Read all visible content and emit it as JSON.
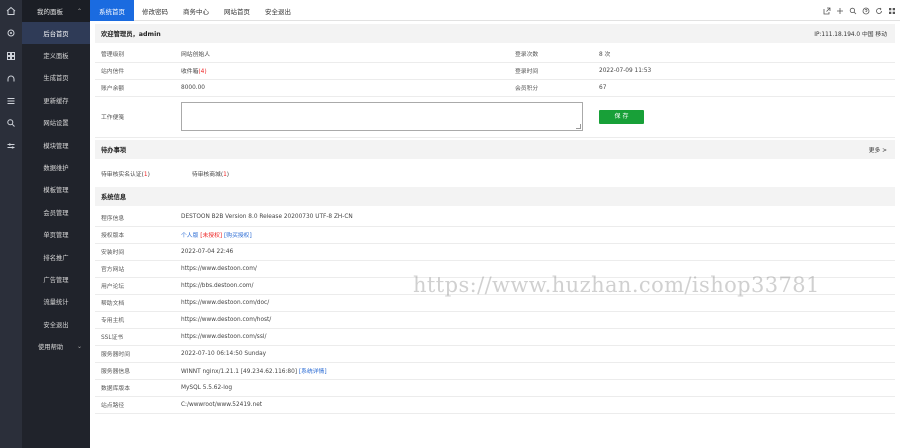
{
  "sidebar": {
    "header_label": "我的面板",
    "items": [
      {
        "label": "后台首页",
        "active": true
      },
      {
        "label": "定义面板"
      },
      {
        "label": "生成首页"
      },
      {
        "label": "更新缓存"
      },
      {
        "label": "网站设置"
      },
      {
        "label": "模块管理"
      },
      {
        "label": "数据维护"
      },
      {
        "label": "模板管理"
      },
      {
        "label": "会员管理"
      },
      {
        "label": "单页管理"
      },
      {
        "label": "排名推广"
      },
      {
        "label": "广告管理"
      },
      {
        "label": "流量统计"
      },
      {
        "label": "安全退出"
      }
    ],
    "footer_label": "使用帮助"
  },
  "rail_icons": [
    "home-icon",
    "gear-icon",
    "grid-icon",
    "user-icon",
    "list-icon",
    "search-icon",
    "sliders-icon"
  ],
  "topbar": {
    "tabs": [
      "系统首页",
      "修改密码",
      "商务中心",
      "网站首页",
      "安全退出"
    ],
    "icons": [
      "external-link-icon",
      "plus-icon",
      "search-icon",
      "help-icon",
      "refresh-icon",
      "grid-icon"
    ]
  },
  "welcome": {
    "title": "欢迎管理员，admin",
    "ip_info": "IP:111.18.194.0 中国 移动"
  },
  "admin_info": {
    "role_label": "管理级别",
    "role_value": "网站创始人",
    "login_count_label": "登录次数",
    "login_count_value": "8 次",
    "messages_label": "站内信件",
    "messages_value": "收件箱",
    "messages_count": "(4)",
    "last_login_label": "登录时间",
    "last_login_value": "2022-07-09 11:53",
    "balance_label": "账户余额",
    "balance_value": "8000.00",
    "points_label": "会员积分",
    "points_value": "67",
    "memo_label": "工作便笺",
    "save_button": "保 存"
  },
  "todo": {
    "title": "待办事项",
    "more": "更多",
    "items": [
      {
        "label": "待审核实名认证",
        "count": "1"
      },
      {
        "label": "待审核商城",
        "count": "1"
      }
    ]
  },
  "sysinfo": {
    "title": "系统信息",
    "rows": [
      {
        "label": "程序信息",
        "value": "DESTOON B2B Version 8.0 Release 20200730 UTF-8 ZH-CN"
      },
      {
        "label": "授权版本",
        "value": "个人版",
        "extra1": "[未授权]",
        "extra2": "[购买授权]"
      },
      {
        "label": "安装时间",
        "value": "2022-07-04 22:46"
      },
      {
        "label": "官方网站",
        "value": "https://www.destoon.com/"
      },
      {
        "label": "用户论坛",
        "value": "https://bbs.destoon.com/"
      },
      {
        "label": "帮助文档",
        "value": "https://www.destoon.com/doc/"
      },
      {
        "label": "专用主机",
        "value": "https://www.destoon.com/host/"
      },
      {
        "label": "SSL证书",
        "value": "https://www.destoon.com/ssl/"
      },
      {
        "label": "服务器时间",
        "value": "2022-07-10 06:14:50 Sunday"
      },
      {
        "label": "服务器信息",
        "value": "WINNT nginx/1.21.1 [49.234.62.116:80]",
        "extra1": "[系统详情]"
      },
      {
        "label": "数据库版本",
        "value": "MySQL 5.5.62-log"
      },
      {
        "label": "站点路径",
        "value": "C:/wwwroot/www.52419.net"
      }
    ]
  },
  "watermark": "https://www.huzhan.com/ishop33781",
  "colors": {
    "accent": "#1a6be0",
    "sidebar_bg": "#20232b",
    "rail_bg": "#2b2f3a",
    "save_green": "#18a038",
    "red": "#e22222",
    "link_blue": "#2a6bd4"
  }
}
